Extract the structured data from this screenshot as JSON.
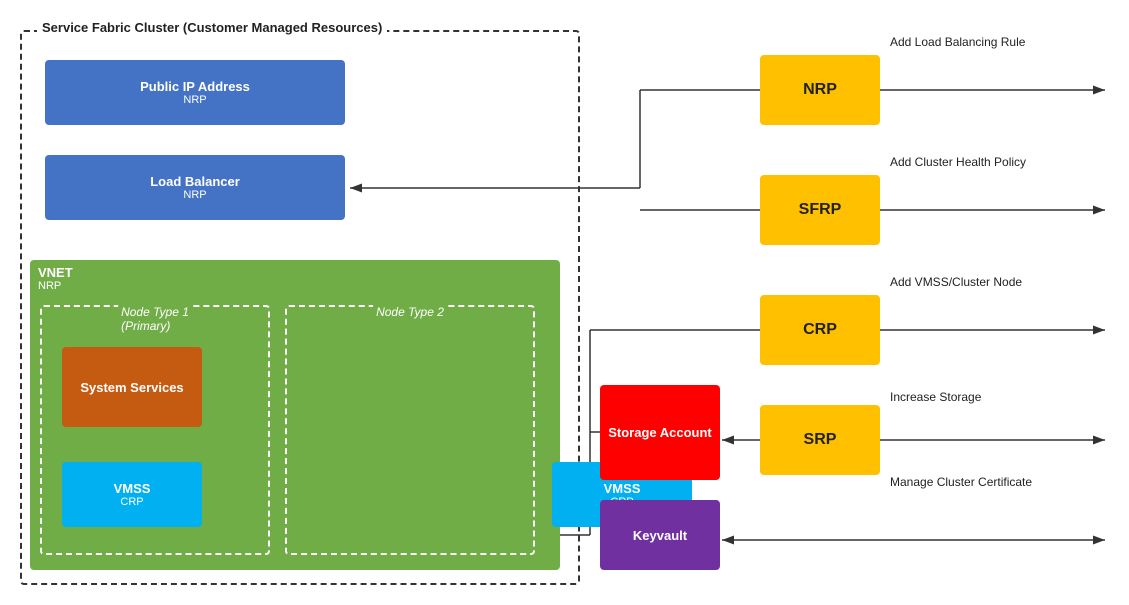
{
  "diagram": {
    "title": "Service Fabric Cluster (Customer Managed Resources)",
    "boxes": {
      "public_ip": {
        "label": "Public IP Address",
        "sub": "NRP"
      },
      "load_balancer": {
        "label": "Load Balancer",
        "sub": "NRP"
      },
      "vnet": {
        "label": "VNET",
        "sub": "NRP"
      },
      "node_type_1": {
        "label": "Node Type 1",
        "sub": "(Primary)"
      },
      "node_type_2": {
        "label": "Node Type 2"
      },
      "system_services": {
        "label": "System Services"
      },
      "vmss_1": {
        "label": "VMSS",
        "sub": "CRP"
      },
      "vmss_2": {
        "label": "VMSS",
        "sub": "CRP"
      },
      "storage_account": {
        "label": "Storage Account"
      },
      "keyvault": {
        "label": "Keyvault"
      },
      "nrp": {
        "label": "NRP"
      },
      "sfrp": {
        "label": "SFRP"
      },
      "crp": {
        "label": "CRP"
      },
      "srp": {
        "label": "SRP"
      }
    },
    "labels": {
      "add_load_balancing_rule": "Add Load Balancing Rule",
      "add_cluster_health_policy": "Add Cluster Health Policy",
      "add_vmss_cluster_node": "Add VMSS/Cluster Node",
      "increase_storage": "Increase Storage",
      "manage_cluster_certificate": "Manage Cluster Certificate"
    }
  }
}
